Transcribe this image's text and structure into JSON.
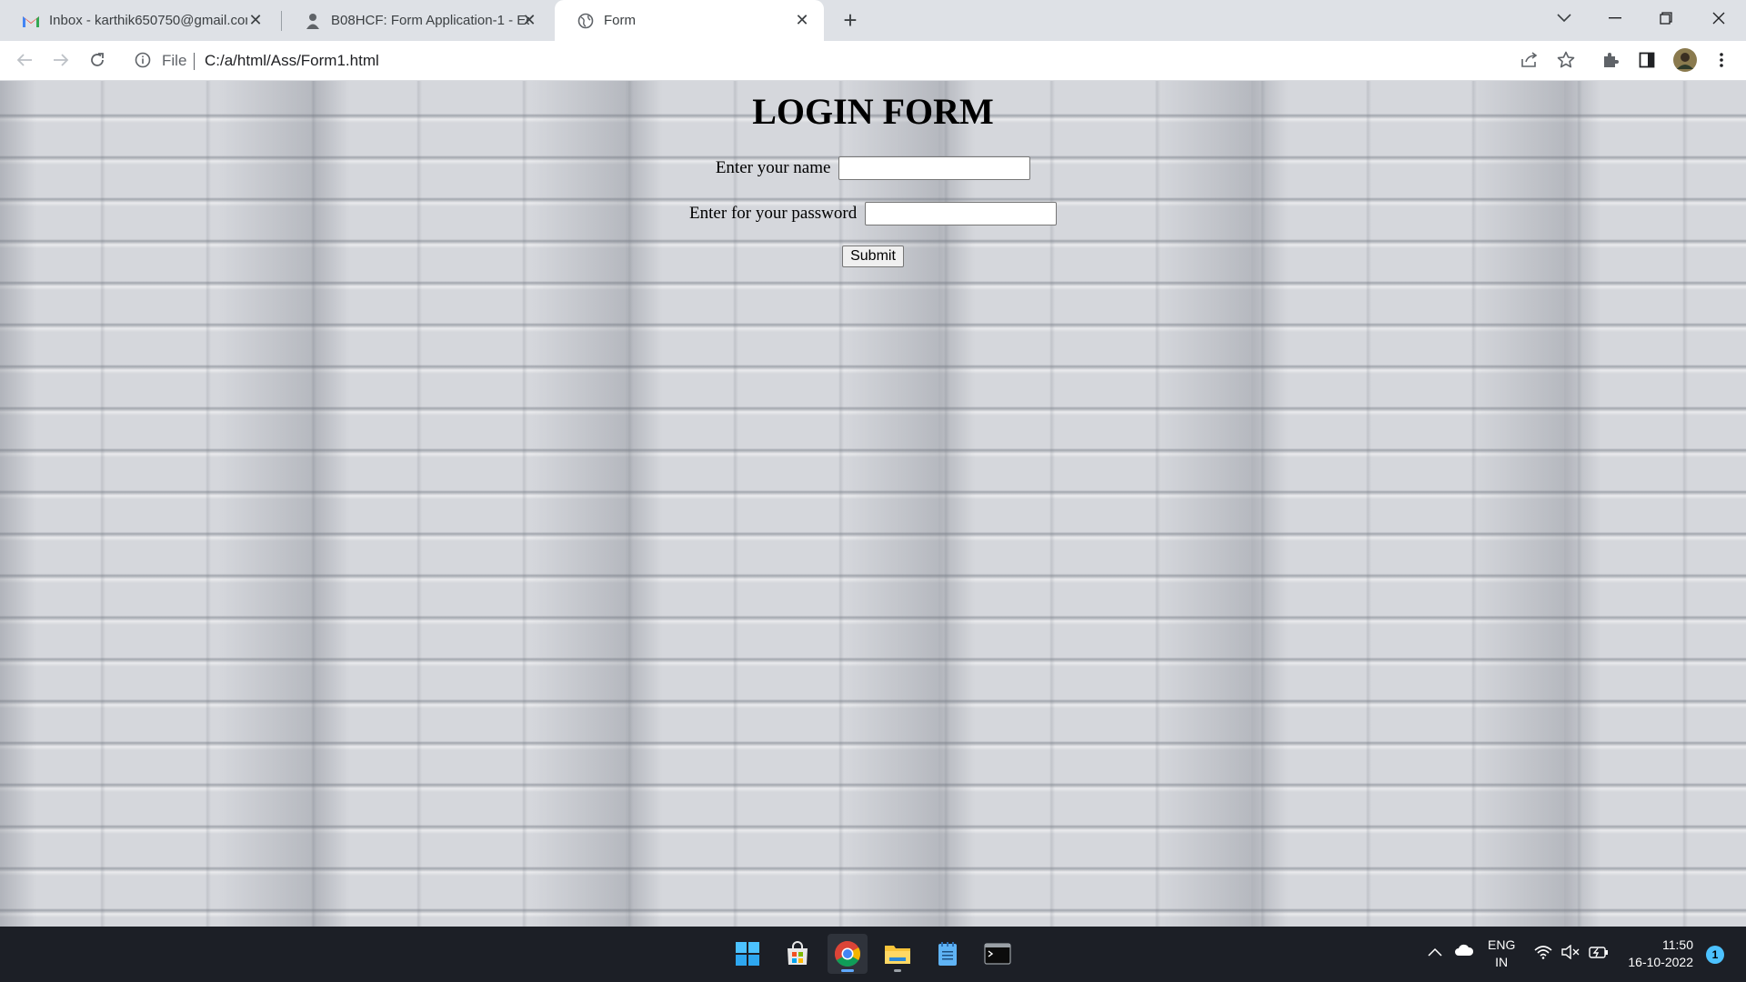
{
  "browser": {
    "tabs": [
      {
        "title": "Inbox - karthik650750@gmail.com",
        "icon": "gmail-icon"
      },
      {
        "title": "B08HCF: Form Application-1 - Ed",
        "icon": "site-icon"
      },
      {
        "title": "Form",
        "icon": "globe-icon",
        "active": true
      }
    ],
    "address": {
      "scheme_label": "File",
      "url": "C:/a/html/Ass/Form1.html"
    }
  },
  "page": {
    "heading": "LOGIN FORM",
    "name_label": "Enter your name",
    "name_value": "",
    "password_label": "Enter for your password",
    "password_value": "",
    "submit_label": "Submit"
  },
  "taskbar": {
    "apps": [
      "windows-start-icon",
      "microsoft-store-icon",
      "chrome-icon",
      "file-explorer-icon",
      "notepad-icon",
      "terminal-icon"
    ],
    "language": "ENG",
    "region": "IN",
    "time": "11:50",
    "date": "16-10-2022",
    "notification_count": "1"
  },
  "colors": {
    "taskbar": "#1c1f26",
    "tabbar": "#dee1e6",
    "accent": "#1a73e8"
  }
}
